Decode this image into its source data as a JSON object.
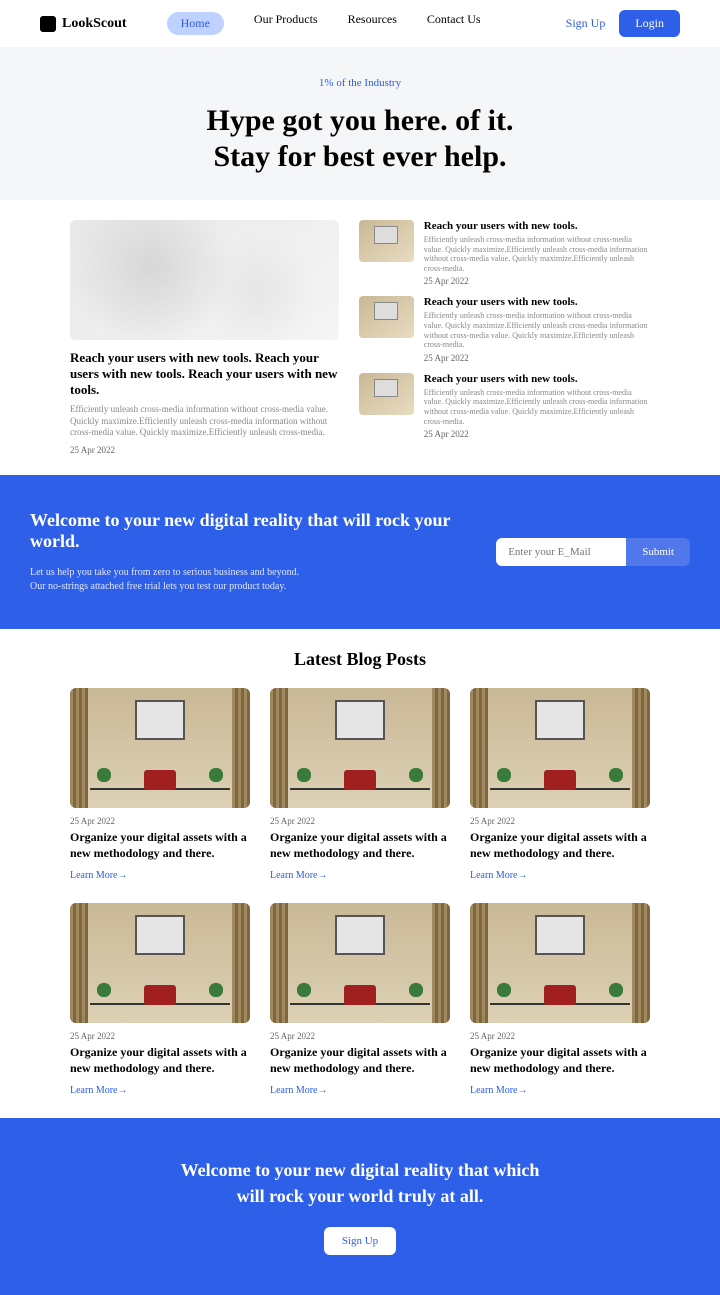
{
  "nav": {
    "logo": "LookScout",
    "links": [
      "Home",
      "Our Products",
      "Resources",
      "Contact Us"
    ],
    "signup": "Sign Up",
    "login": "Login"
  },
  "hero": {
    "tag": "1% of the Industry",
    "title_line1": "Hype got you here. of it.",
    "title_line2": "Stay for best ever help."
  },
  "main": {
    "big": {
      "title": "Reach your users with new tools. Reach your users with new tools. Reach your users with new tools.",
      "body": "Efficiently unleash cross-media information without cross-media value. Quickly maximize.Efficiently unleash cross-media information without cross-media value. Quickly maximize.Efficiently unleash cross-media.",
      "date": "25 Apr 2022"
    },
    "side": [
      {
        "title": "Reach your users with new tools.",
        "body": "Efficiently unleash cross-media information without cross-media value. Quickly maximize.Efficiently unleash cross-media information without cross-media value. Quickly maximize.Efficiently unleash cross-media.",
        "date": "25 Apr 2022"
      },
      {
        "title": "Reach your users with new tools.",
        "body": "Efficiently unleash cross-media information without cross-media value. Quickly maximize.Efficiently unleash cross-media information without cross-media value. Quickly maximize.Efficiently unleash cross-media.",
        "date": "25 Apr 2022"
      },
      {
        "title": "Reach your users with new tools.",
        "body": "Efficiently unleash cross-media information without cross-media value. Quickly maximize.Efficiently unleash cross-media information without cross-media value. Quickly maximize.Efficiently unleash cross-media.",
        "date": "25 Apr 2022"
      }
    ]
  },
  "cta": {
    "title": "Welcome to your new digital reality that will rock your world.",
    "body_line1": "Let us help you take you from zero to serious business and beyond.",
    "body_line2": "Our no-strings attached free trial lets you test our product today.",
    "placeholder": "Enter your E_Mail",
    "submit": "Submit"
  },
  "blog": {
    "title": "Latest Blog Posts",
    "posts": [
      {
        "date": "25 Apr 2022",
        "title": "Organize your digital assets with a new methodology and there.",
        "learn": "Learn More→"
      },
      {
        "date": "25 Apr 2022",
        "title": "Organize your digital assets with a new methodology and there.",
        "learn": "Learn More→"
      },
      {
        "date": "25 Apr 2022",
        "title": "Organize your digital assets with a new methodology and there.",
        "learn": "Learn More→"
      },
      {
        "date": "25 Apr 2022",
        "title": "Organize your digital assets with a new methodology and there.",
        "learn": "Learn More→"
      },
      {
        "date": "25 Apr 2022",
        "title": "Organize your digital assets with a new methodology and there.",
        "learn": "Learn More→"
      },
      {
        "date": "25 Apr 2022",
        "title": "Organize your digital assets with a new methodology and there.",
        "learn": "Learn More→"
      }
    ]
  },
  "bottom": {
    "title_line1": "Welcome to your new digital reality that which",
    "title_line2": "will rock your world truly at all.",
    "button": "Sign Up"
  }
}
